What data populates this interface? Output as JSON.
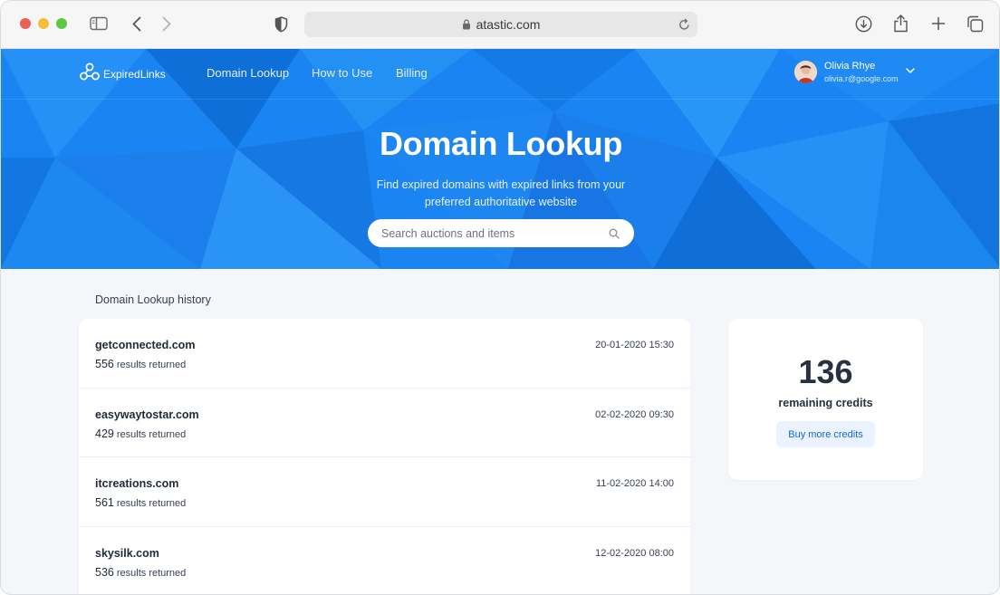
{
  "browser": {
    "url": "atastic.com"
  },
  "header": {
    "logo_text": "ExpiredLinks",
    "nav": [
      {
        "label": "Domain Lookup"
      },
      {
        "label": "How to Use"
      },
      {
        "label": "Billing"
      }
    ],
    "user": {
      "name": "Olivia Rhye",
      "email": "olivia.r@google.com"
    }
  },
  "hero": {
    "title": "Domain Lookup",
    "subtitle": "Find expired domains with expired links from your preferred authoritative website",
    "search_placeholder": "Search auctions and items"
  },
  "history": {
    "label": "Domain Lookup history",
    "suffix": "results returned",
    "rows": [
      {
        "domain": "getconnected.com",
        "count": "556",
        "date": "20-01-2020 15:30"
      },
      {
        "domain": "easywaytostar.com",
        "count": "429",
        "date": "02-02-2020 09:30"
      },
      {
        "domain": "itcreations.com",
        "count": "561",
        "date": "11-02-2020 14:00"
      },
      {
        "domain": "skysilk.com",
        "count": "536",
        "date": "12-02-2020 08:00"
      }
    ]
  },
  "credits": {
    "value": "136",
    "label": "remaining credits",
    "button_label": "Buy more credits"
  },
  "colors": {
    "brand": "#1a82f0",
    "button_text": "#1565d8",
    "button_bg": "#eaf3ff"
  }
}
